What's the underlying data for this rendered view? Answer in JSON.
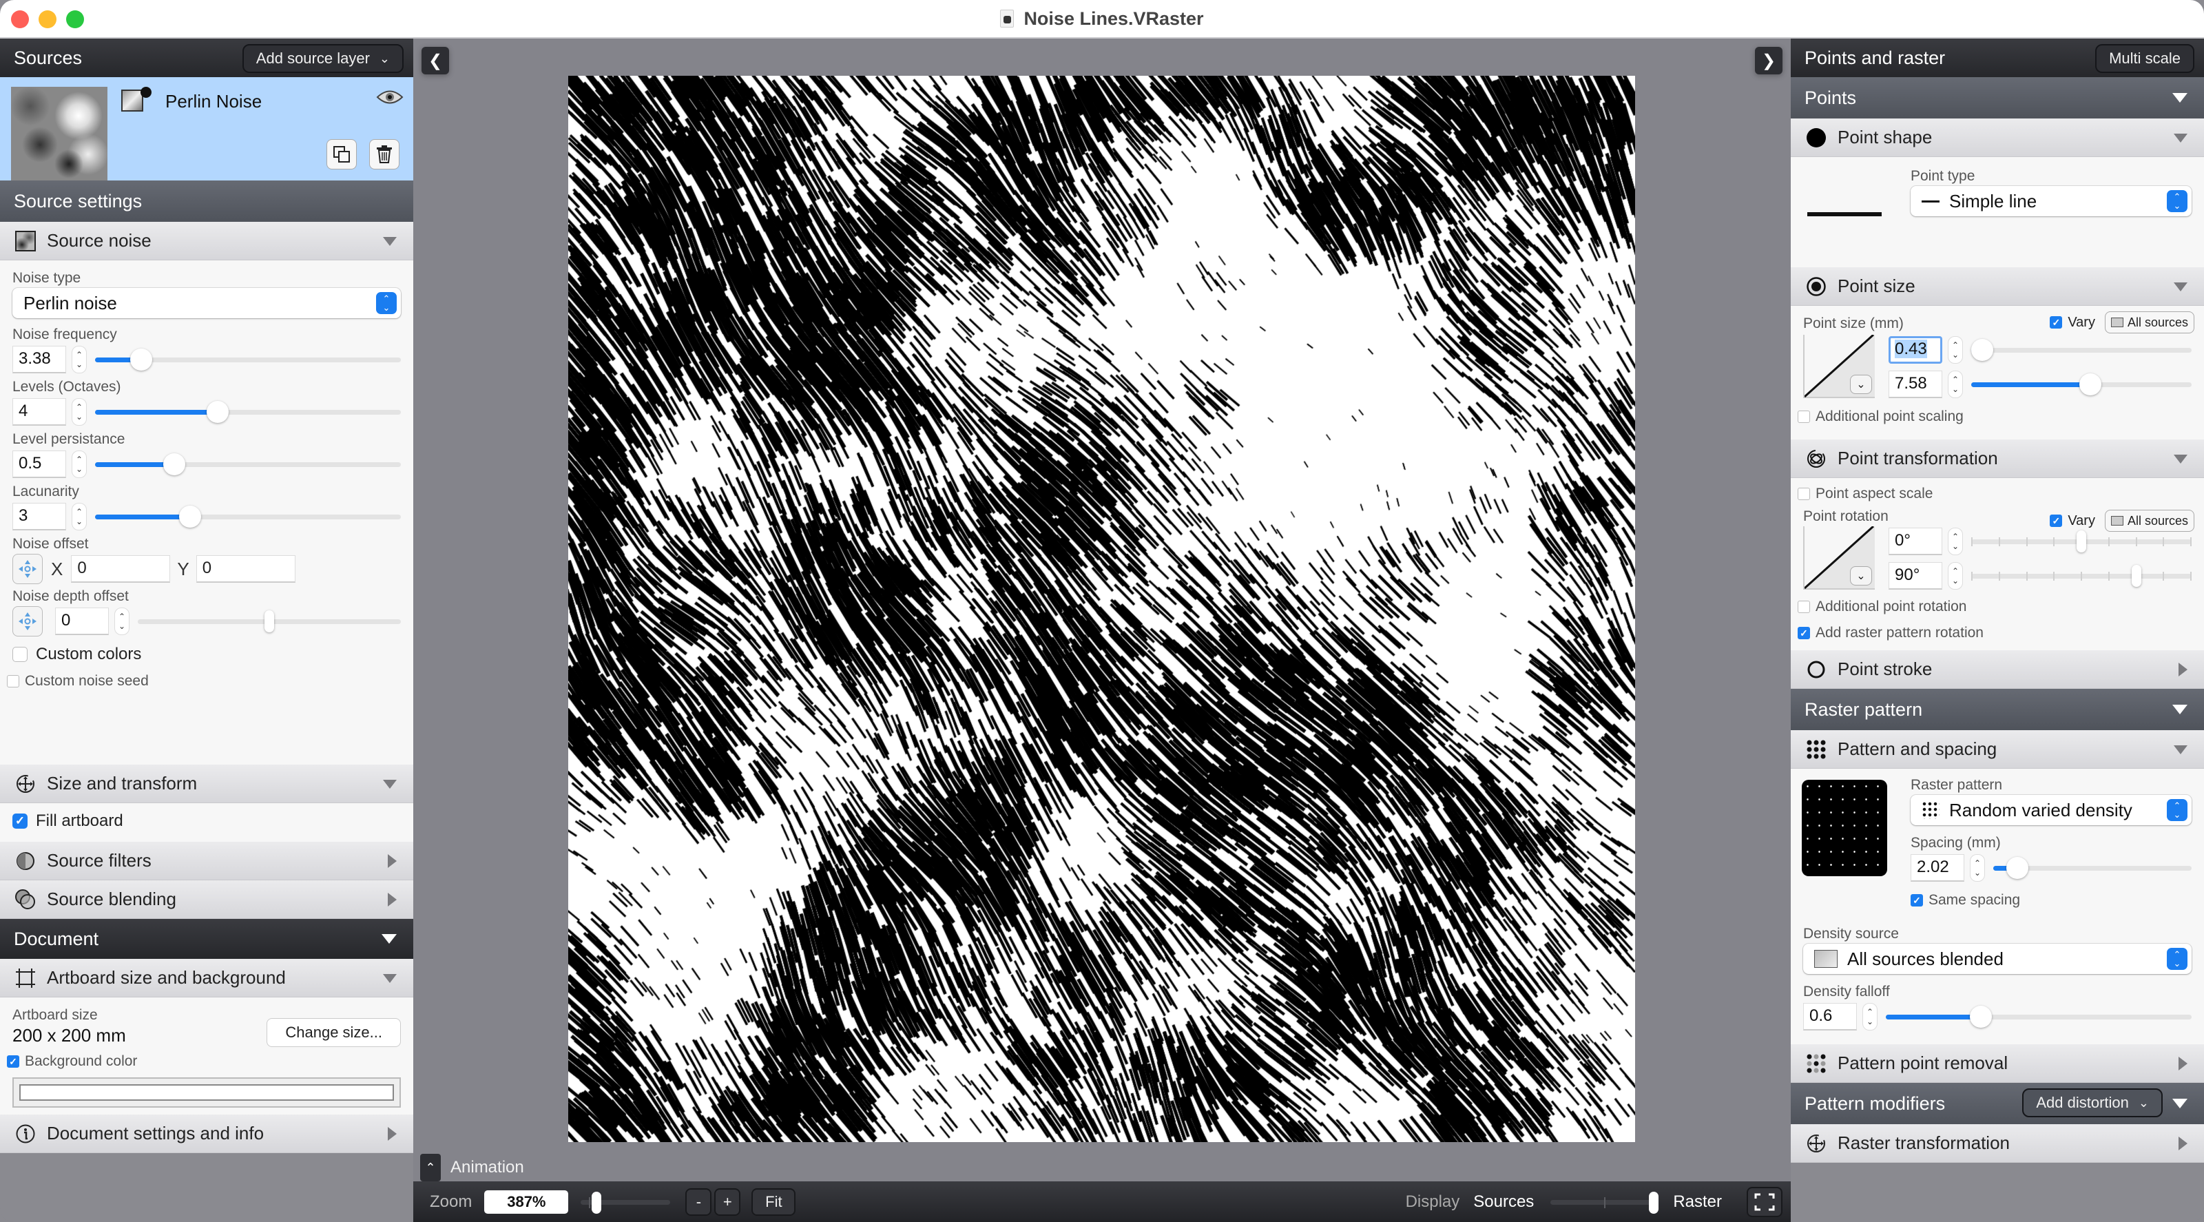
{
  "window": {
    "title": "Noise Lines.VRaster"
  },
  "left": {
    "sources_header": "Sources",
    "add_source_label": "Add source layer",
    "source_layer": {
      "name": "Perlin Noise",
      "visible": true
    },
    "source_settings_header": "Source settings",
    "source_noise": {
      "title": "Source noise",
      "noise_type_label": "Noise type",
      "noise_type_value": "Perlin noise",
      "frequency": {
        "label": "Noise frequency",
        "value": "3.38",
        "fraction": 0.15
      },
      "levels": {
        "label": "Levels (Octaves)",
        "value": "4",
        "fraction": 0.4
      },
      "persistance": {
        "label": "Level persistance",
        "value": "0.5",
        "fraction": 0.26
      },
      "lacunarity": {
        "label": "Lacunarity",
        "value": "3",
        "fraction": 0.31
      },
      "offset": {
        "label": "Noise offset",
        "x_label": "X",
        "x_value": "0",
        "y_label": "Y",
        "y_value": "0"
      },
      "depth": {
        "label": "Noise depth offset",
        "value": "0",
        "fraction": 0.5
      },
      "custom_colors": {
        "label": "Custom colors",
        "checked": false
      },
      "custom_seed": {
        "label": "Custom noise seed",
        "checked": false
      }
    },
    "size_transform": {
      "title": "Size and transform",
      "fill_artboard": {
        "label": "Fill artboard",
        "checked": true
      }
    },
    "source_filters": "Source filters",
    "source_blending": "Source blending",
    "document_header": "Document",
    "artboard": {
      "title": "Artboard size and background",
      "size_label": "Artboard size",
      "size_value": "200 x 200 mm",
      "change_size_label": "Change size...",
      "bg_color": {
        "label": "Background color",
        "checked": true,
        "color": "#ffffff"
      }
    },
    "document_settings": "Document settings and info"
  },
  "right": {
    "header": "Points and raster",
    "multi_scale_label": "Multi scale",
    "points_header": "Points",
    "point_shape": {
      "title": "Point shape",
      "type_label": "Point type",
      "type_value": "Simple line"
    },
    "point_size": {
      "title": "Point size",
      "label": "Point size (mm)",
      "vary_label": "Vary",
      "vary_checked": true,
      "all_sources_label": "All sources",
      "min_value": "0.43",
      "min_fraction": 0.05,
      "max_value": "7.58",
      "max_fraction": 0.54,
      "additional_scaling": {
        "label": "Additional point scaling",
        "checked": false
      }
    },
    "point_transformation": {
      "title": "Point transformation",
      "aspect_scale": {
        "label": "Point aspect scale",
        "checked": false
      },
      "rotation_label": "Point rotation",
      "vary_label": "Vary",
      "vary_checked": true,
      "all_sources_label": "All sources",
      "min_value": "0°",
      "min_fraction": 0.5,
      "max_value": "90°",
      "max_fraction": 0.75,
      "additional_rotation": {
        "label": "Additional point rotation",
        "checked": false
      },
      "raster_rotation": {
        "label": "Add raster pattern rotation",
        "checked": true
      }
    },
    "point_stroke": "Point stroke",
    "raster_header": "Raster pattern",
    "pattern_spacing": {
      "title": "Pattern and spacing",
      "pattern_label": "Raster pattern",
      "pattern_value": "Random varied density",
      "spacing_label": "Spacing (mm)",
      "spacing_value": "2.02",
      "spacing_fraction": 0.12,
      "same_spacing": {
        "label": "Same spacing",
        "checked": true
      },
      "density_source_label": "Density source",
      "density_source_value": "All sources blended",
      "falloff_label": "Density falloff",
      "falloff_value": "0.6",
      "falloff_fraction": 0.31
    },
    "pattern_point_removal": "Pattern point removal",
    "modifiers_header": "Pattern modifiers",
    "add_distortion_label": "Add distortion",
    "raster_transformation": "Raster transformation"
  },
  "bottom": {
    "animation_label": "Animation",
    "zoom_label": "Zoom",
    "zoom_value": "387%",
    "zoom_fraction": 0.18,
    "minus": "-",
    "plus": "+",
    "fit": "Fit",
    "display_label": "Display",
    "sources_label": "Sources",
    "raster_label": "Raster",
    "display_fraction": 1.0
  }
}
